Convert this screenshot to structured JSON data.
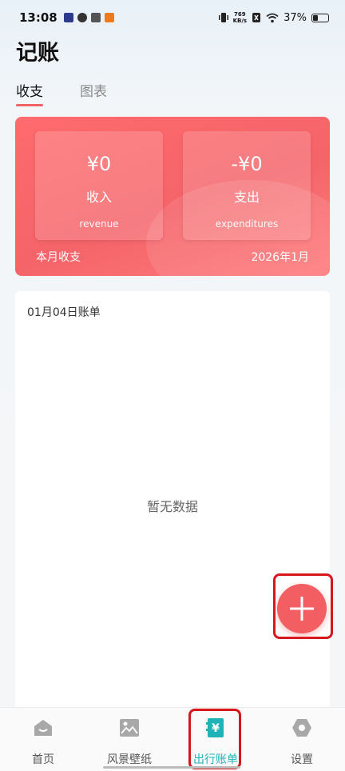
{
  "status_bar": {
    "time": "13:08",
    "net_speed_value": "769",
    "net_speed_unit": "KB/s",
    "battery_percent": "37%",
    "battery_level": 0.37
  },
  "header": {
    "title": "记账"
  },
  "tabs": [
    {
      "label": "收支",
      "active": true
    },
    {
      "label": "图表",
      "active": false
    }
  ],
  "summary": {
    "income": {
      "amount": "¥0",
      "label": "收入",
      "sub": "revenue"
    },
    "expense": {
      "amount": "-¥0",
      "label": "支出",
      "sub": "expenditures"
    },
    "footer_left": "本月收支",
    "footer_right": "2026年1月"
  },
  "bill": {
    "date_label": "01月04日账单",
    "empty_text": "暂无数据"
  },
  "bottom_nav": [
    {
      "label": "首页",
      "icon": "home-icon",
      "active": false
    },
    {
      "label": "风景壁纸",
      "icon": "image-icon",
      "active": false
    },
    {
      "label": "出行账单",
      "icon": "yen-bill-icon",
      "active": true
    },
    {
      "label": "设置",
      "icon": "settings-icon",
      "active": false
    }
  ],
  "colors": {
    "accent_red": "#f25e62",
    "active_teal": "#1fb3b8",
    "highlight_outline": "#d8171d"
  }
}
